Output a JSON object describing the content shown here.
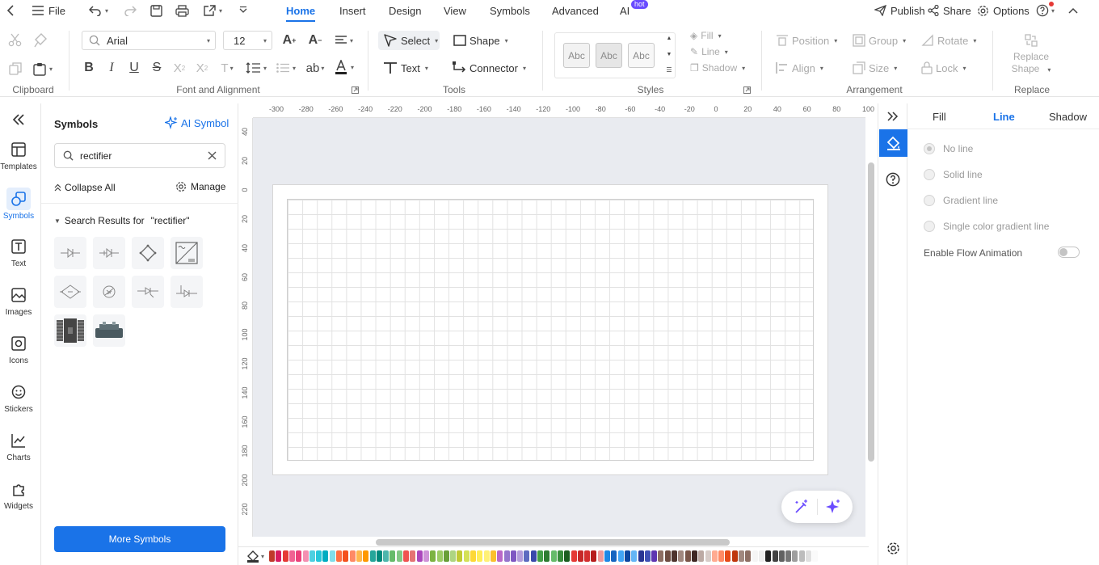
{
  "topbar": {
    "file_label": "File",
    "tabs": [
      {
        "label": "Home",
        "active": true
      },
      {
        "label": "Insert"
      },
      {
        "label": "Design"
      },
      {
        "label": "View"
      },
      {
        "label": "Symbols"
      },
      {
        "label": "Advanced"
      },
      {
        "label": "AI"
      }
    ],
    "ai_badge": "hot",
    "publish_label": "Publish",
    "share_label": "Share",
    "options_label": "Options"
  },
  "ribbon": {
    "groups": {
      "clipboard": "Clipboard",
      "font_alignment": "Font and Alignment",
      "tools": "Tools",
      "styles": "Styles",
      "arrangement": "Arrangement",
      "replace": "Replace"
    },
    "font_name": "Arial",
    "font_size": "12",
    "select_label": "Select",
    "shape_label": "Shape",
    "text_label": "Text",
    "connector_label": "Connector",
    "style_swatches": [
      "Abc",
      "Abc",
      "Abc"
    ],
    "fill_label": "Fill",
    "line_label": "Line",
    "shadow_label": "Shadow",
    "position_label": "Position",
    "group_label": "Group",
    "rotate_label": "Rotate",
    "align_label": "Align",
    "size_label": "Size",
    "lock_label": "Lock",
    "replace_shape_line1": "Replace",
    "replace_shape_line2": "Shape"
  },
  "leftrail": {
    "items": [
      {
        "label": "Templates",
        "icon": "templates-icon"
      },
      {
        "label": "Symbols",
        "icon": "symbols-icon",
        "active": true
      },
      {
        "label": "Text",
        "icon": "text-icon"
      },
      {
        "label": "Images",
        "icon": "images-icon"
      },
      {
        "label": "Icons",
        "icon": "icons-icon"
      },
      {
        "label": "Stickers",
        "icon": "stickers-icon"
      },
      {
        "label": "Charts",
        "icon": "charts-icon"
      },
      {
        "label": "Widgets",
        "icon": "widgets-icon"
      }
    ]
  },
  "symbols_panel": {
    "title": "Symbols",
    "ai_symbol_label": "AI Symbol",
    "search_value": "rectifier",
    "collapse_all_label": "Collapse All",
    "manage_label": "Manage",
    "results_prefix": "Search Results for",
    "results_query": "\"rectifier\"",
    "more_symbols_label": "More Symbols"
  },
  "rulers": {
    "horizontal": [
      "-300",
      "-280",
      "-260",
      "-240",
      "-220",
      "-200",
      "-180",
      "-160",
      "-140",
      "-120",
      "-100",
      "-80",
      "-60",
      "-40",
      "-20",
      "0",
      "20",
      "40",
      "60",
      "80",
      "100"
    ],
    "vertical": [
      "40",
      "20",
      "0",
      "20",
      "40",
      "60",
      "80",
      "100",
      "120",
      "140",
      "160",
      "180",
      "200",
      "220"
    ]
  },
  "right_panel": {
    "tabs": [
      {
        "label": "Fill"
      },
      {
        "label": "Line",
        "active": true
      },
      {
        "label": "Shadow"
      }
    ],
    "options": [
      {
        "label": "No line",
        "selected": true
      },
      {
        "label": "Solid line"
      },
      {
        "label": "Gradient line"
      },
      {
        "label": "Single color gradient line"
      }
    ],
    "flow_animation_label": "Enable Flow Animation",
    "flow_animation_on": false
  },
  "colors": {
    "accent": "#1a73e8",
    "palette": [
      "#c0392b",
      "#d81b60",
      "#e53935",
      "#f06292",
      "#ec407a",
      "#f48fb1",
      "#4dd0e1",
      "#26c6da",
      "#00acc1",
      "#80deea",
      "#ff7043",
      "#f4511e",
      "#ff8a65",
      "#ffb74d",
      "#ff9800",
      "#26a69a",
      "#00897b",
      "#4db6ac",
      "#66bb6a",
      "#81c784",
      "#ef5350",
      "#e57373",
      "#ab47bc",
      "#ce93d8",
      "#7cb342",
      "#9ccc65",
      "#689f38",
      "#aed581",
      "#c0ca33",
      "#d4e157",
      "#fdd835",
      "#ffee58",
      "#fff176",
      "#fbc02d",
      "#ba68c8",
      "#9575cd",
      "#7e57c2",
      "#b39ddb",
      "#5c6bc0",
      "#3949ab",
      "#43a047",
      "#2e7d32",
      "#66bb6a",
      "#388e3c",
      "#1b5e20",
      "#e53935",
      "#c62828",
      "#d32f2f",
      "#b71c1c",
      "#ef9a9a",
      "#1e88e5",
      "#1565c0",
      "#42a5f5",
      "#0d47a1",
      "#64b5f6",
      "#283593",
      "#3f51b5",
      "#5e35b1",
      "#8d6e63",
      "#6d4c41",
      "#4e342e",
      "#a1887f",
      "#795548",
      "#3e2723",
      "#bcaaa4",
      "#d7ccc8",
      "#ffab91",
      "#ff8a65",
      "#e64a19",
      "#bf360c",
      "#a1887f",
      "#8d6e63",
      "#f5f5f5",
      "#eeeeee",
      "#212121",
      "#424242",
      "#616161",
      "#757575",
      "#9e9e9e",
      "#bdbdbd",
      "#e0e0e0",
      "#fafafa"
    ]
  }
}
